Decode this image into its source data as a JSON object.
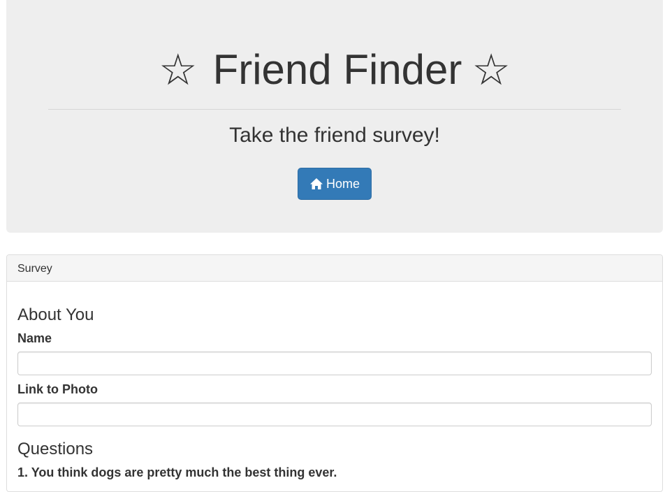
{
  "header": {
    "title": "Friend Finder",
    "star_left": "☆",
    "star_right": "☆",
    "subtitle": "Take the friend survey!",
    "home_button_label": "Home",
    "home_icon": "home-icon"
  },
  "panel": {
    "heading": "Survey",
    "about_title": "About You",
    "name_label": "Name",
    "name_value": "",
    "photo_label": "Link to Photo",
    "photo_value": "",
    "questions_title": "Questions",
    "questions": [
      "1. You think dogs are pretty much the best thing ever."
    ]
  },
  "colors": {
    "jumbotron_bg": "#eeeeee",
    "primary": "#337ab7",
    "text": "#333333"
  }
}
